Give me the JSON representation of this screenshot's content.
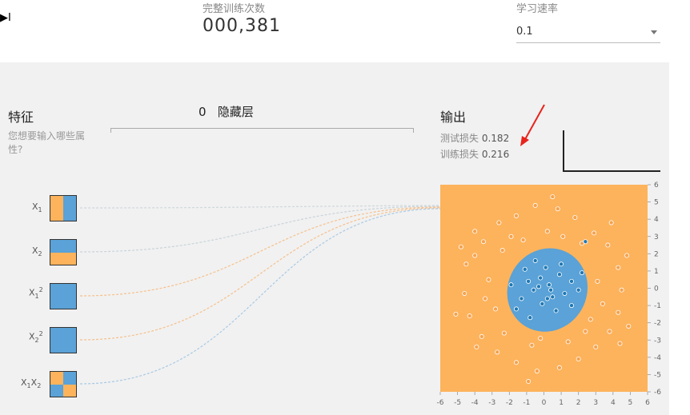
{
  "toolbar": {
    "play_icon": "step-forward-icon",
    "epoch_label": "完整训练次数",
    "epoch_value": "000,381",
    "lr_label": "学习速率",
    "lr_value": "0.1"
  },
  "features": {
    "title": "特征",
    "desc": "您想要输入哪些属性?",
    "items": [
      {
        "id": "x1",
        "label": "X",
        "sub": "1",
        "sup": ""
      },
      {
        "id": "x2",
        "label": "X",
        "sub": "2",
        "sup": ""
      },
      {
        "id": "x1sq",
        "label": "X",
        "sub": "1",
        "sup": "2"
      },
      {
        "id": "x2sq",
        "label": "X",
        "sub": "2",
        "sup": "2"
      },
      {
        "id": "x1x2",
        "label": "X",
        "sub": "1",
        "label2": "X",
        "sub2": "2"
      }
    ]
  },
  "hidden": {
    "count": "0",
    "title": "隐藏层"
  },
  "output": {
    "title": "输出",
    "test_loss_label": "测试损失",
    "test_loss": "0.182",
    "train_loss_label": "训练损失",
    "train_loss": "0.216"
  },
  "colors": {
    "orange": "#f5a24e",
    "blue": "#5aa2d7",
    "dark_blue": "#1f78b4",
    "bg_orange": "#fdb35c",
    "annotation": "#e8231c"
  },
  "chart_data": {
    "type": "scatter",
    "title": "",
    "xlim": [
      -6,
      6
    ],
    "ylim": [
      -6,
      6
    ],
    "x_ticks": [
      -6,
      -5,
      -4,
      -3,
      -2,
      -1,
      0,
      1,
      2,
      3,
      4,
      5,
      6
    ],
    "y_ticks": [
      6,
      5,
      4,
      3,
      2,
      1,
      0,
      -1,
      -2,
      -3,
      -4,
      -5,
      -6
    ],
    "series": [
      {
        "points": [
          [
            -0.2,
            0.6
          ],
          [
            0.3,
            0.2
          ],
          [
            -0.6,
            -0.1
          ],
          [
            0.5,
            -0.5
          ],
          [
            -0.9,
            0.4
          ],
          [
            0.9,
            0.8
          ],
          [
            -0.1,
            -0.9
          ],
          [
            1.2,
            -0.3
          ],
          [
            -1.3,
            -0.6
          ],
          [
            0.1,
            1.2
          ],
          [
            -0.5,
            1.6
          ],
          [
            1.6,
            0.4
          ],
          [
            -1.1,
            1.1
          ],
          [
            0.7,
            -1.3
          ],
          [
            2.2,
            0.9
          ],
          [
            2.0,
            -0.1
          ],
          [
            1.6,
            -1.0
          ],
          [
            -1.6,
            -1.2
          ],
          [
            -0.8,
            -1.7
          ],
          [
            0.4,
            -0.1
          ],
          [
            1.0,
            1.4
          ],
          [
            -0.3,
            0.1
          ],
          [
            0.2,
            -0.6
          ],
          [
            2.4,
            2.7
          ],
          [
            -1.9,
            0.2
          ]
        ]
      },
      {
        "points": [
          [
            -4.5,
            1.4
          ],
          [
            -4.0,
            1.9
          ],
          [
            -3.5,
            2.7
          ],
          [
            -2.6,
            3.8
          ],
          [
            -1.6,
            4.2
          ],
          [
            -0.5,
            4.8
          ],
          [
            0.8,
            4.6
          ],
          [
            1.8,
            4.1
          ],
          [
            2.9,
            3.2
          ],
          [
            3.7,
            2.5
          ],
          [
            4.3,
            1.2
          ],
          [
            4.5,
            -0.1
          ],
          [
            4.3,
            -1.4
          ],
          [
            3.8,
            -2.5
          ],
          [
            3.0,
            -3.4
          ],
          [
            2.0,
            -4.1
          ],
          [
            0.9,
            -4.6
          ],
          [
            -0.4,
            -4.8
          ],
          [
            -1.6,
            -4.3
          ],
          [
            -2.7,
            -3.7
          ],
          [
            -3.6,
            -2.8
          ],
          [
            -4.3,
            -1.6
          ],
          [
            -4.6,
            -0.3
          ],
          [
            -3.2,
            0.5
          ],
          [
            -2.8,
            -1.2
          ],
          [
            3.1,
            0.4
          ],
          [
            2.7,
            -1.8
          ],
          [
            -1.9,
            3.0
          ],
          [
            0.2,
            3.3
          ],
          [
            1.4,
            -3.1
          ],
          [
            -0.7,
            -3.3
          ],
          [
            -4.0,
            3.3
          ],
          [
            3.9,
            3.8
          ],
          [
            4.4,
            -3.2
          ],
          [
            -3.9,
            -3.4
          ],
          [
            -1.2,
            2.8
          ],
          [
            2.2,
            2.6
          ],
          [
            -2.4,
            2.2
          ],
          [
            2.4,
            -2.5
          ],
          [
            -2.3,
            -2.6
          ],
          [
            -0.2,
            -2.9
          ],
          [
            3.4,
            -0.9
          ],
          [
            -3.4,
            -0.6
          ],
          [
            1.1,
            3.0
          ],
          [
            -4.8,
            2.4
          ],
          [
            4.8,
            1.9
          ],
          [
            0.5,
            5.3
          ],
          [
            -0.9,
            -5.4
          ],
          [
            4.9,
            -2.2
          ],
          [
            -5.1,
            -1.5
          ]
        ]
      }
    ],
    "legend": "none"
  },
  "x_axis": {
    "ticks": [
      "-6",
      "-5",
      "-4",
      "-3",
      "-2",
      "-1",
      "0",
      "1",
      "2",
      "3",
      "4",
      "5",
      "6"
    ]
  },
  "y_axis": {
    "ticks": [
      "6",
      "5",
      "4",
      "3",
      "2",
      "1",
      "0",
      "-1",
      "-2",
      "-3",
      "-4",
      "-5",
      "-6"
    ]
  }
}
